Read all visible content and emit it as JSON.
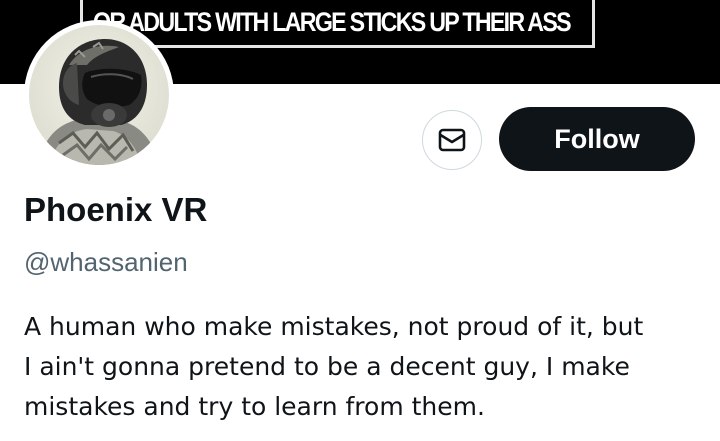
{
  "banner": {
    "text": "OR ADULTS WITH LARGE STICKS UP THEIR ASS"
  },
  "profile": {
    "display_name": "Phoenix VR",
    "handle": "@whassanien",
    "bio_lines": [
      "A human who make mistakes, not proud of it, but",
      "I ain't gonna pretend to be a decent guy, I make",
      "mistakes and try to learn from them."
    ]
  },
  "actions": {
    "message_icon": "envelope-icon",
    "follow_label": "Follow"
  },
  "colors": {
    "text_primary": "#0f1419",
    "text_secondary": "#536471",
    "button_dark": "#0f1419",
    "border": "#cfd9de",
    "banner_bg": "#000000"
  }
}
